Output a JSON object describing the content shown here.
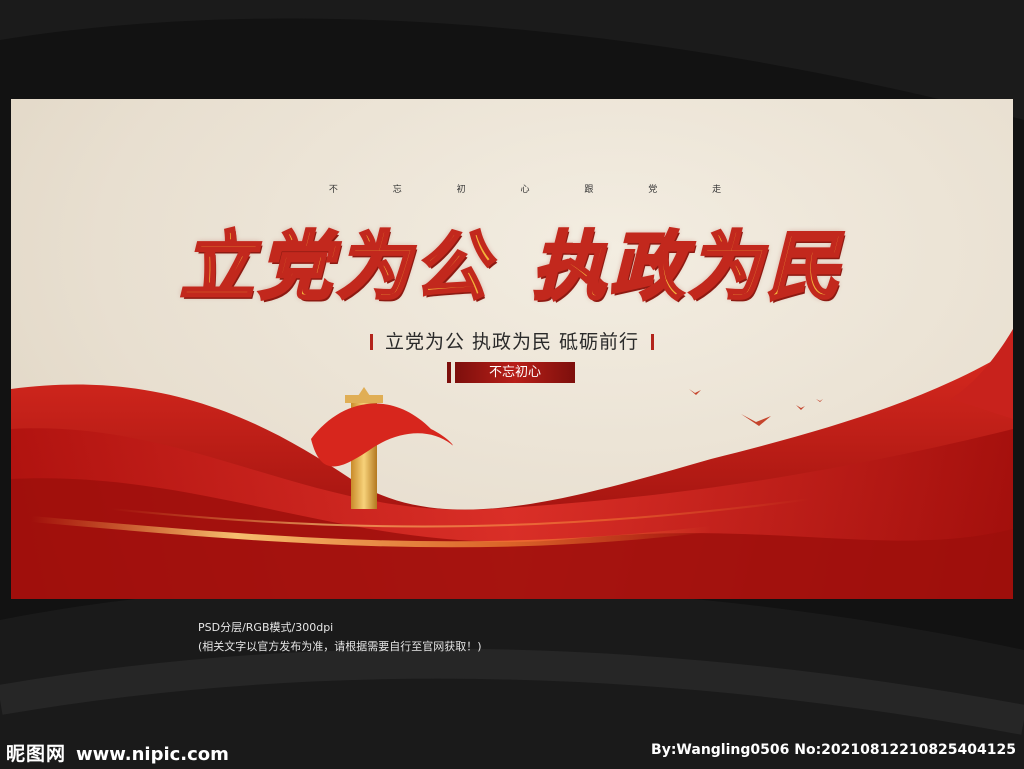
{
  "banner": {
    "top_line": "不 忘 初 心 跟 党 走",
    "title_left": "立党为公",
    "title_right": "执政为民",
    "slogan": "立党为公  执政为民  砥砺前行",
    "tag": "不忘初心"
  },
  "meta": {
    "format": "PSD分层/RGB模式/300dpi",
    "note": "(相关文字以官方发布为准，请根据需要自行至官网获取！)"
  },
  "footer": {
    "site_name": "昵图网",
    "site_url": "www.nipic.com",
    "credit": "By:Wangling0506 No:20210812210825404125"
  },
  "colors": {
    "page_bg": "#121212",
    "ribbon_red": "#c8221c",
    "title_gold": "#f3b43a",
    "title_outline": "#c2281d"
  },
  "icons": [
    "huabiao-column-icon",
    "red-flag-icon",
    "bird-icon"
  ]
}
